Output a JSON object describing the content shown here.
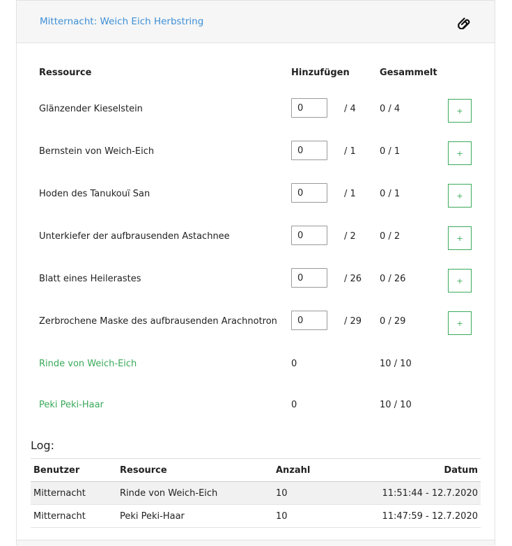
{
  "header": {
    "title": "Mitternacht: Weich Eich Herbstring",
    "icon": "paperclip-icon"
  },
  "columns": {
    "resource": "Ressource",
    "add": "Hinzufügen",
    "collected": "Gesammelt"
  },
  "resources": [
    {
      "name": "Glänzender Kieselstein",
      "input_value": "0",
      "max": "/ 4",
      "collected": "0 / 4",
      "add_label": "+"
    },
    {
      "name": "Bernstein von Weich-Eich",
      "input_value": "0",
      "max": "/ 1",
      "collected": "0 / 1",
      "add_label": "+"
    },
    {
      "name": "Hoden des Tanukouï San",
      "input_value": "0",
      "max": "/ 1",
      "collected": "0 / 1",
      "add_label": "+"
    },
    {
      "name": "Unterkiefer der aufbrausenden Astachnee",
      "input_value": "0",
      "max": "/ 2",
      "collected": "0 / 2",
      "add_label": "+"
    },
    {
      "name": "Blatt eines Heilerastes",
      "input_value": "0",
      "max": "/ 26",
      "collected": "0 / 26",
      "add_label": "+"
    },
    {
      "name": "Zerbrochene Maske des aufbrausenden Arachnotron",
      "input_value": "0",
      "max": "/ 29",
      "collected": "0 / 29",
      "add_label": "+"
    }
  ],
  "completed": [
    {
      "name": "Rinde von Weich-Eich",
      "add": "0",
      "collected": "10 / 10"
    },
    {
      "name": "Peki Peki-Haar",
      "add": "0",
      "collected": "10 / 10"
    }
  ],
  "colors": {
    "link": "#3d8fd6",
    "success": "#3aaa5a"
  },
  "log": {
    "title": "Log:",
    "headers": {
      "user": "Benutzer",
      "resource": "Resource",
      "count": "Anzahl",
      "date": "Datum"
    },
    "rows": [
      {
        "user": "Mitternacht",
        "resource": "Rinde von Weich-Eich",
        "count": "10",
        "date": "11:51:44 - 12.7.2020"
      },
      {
        "user": "Mitternacht",
        "resource": "Peki Peki-Haar",
        "count": "10",
        "date": "11:47:59 - 12.7.2020"
      }
    ]
  }
}
